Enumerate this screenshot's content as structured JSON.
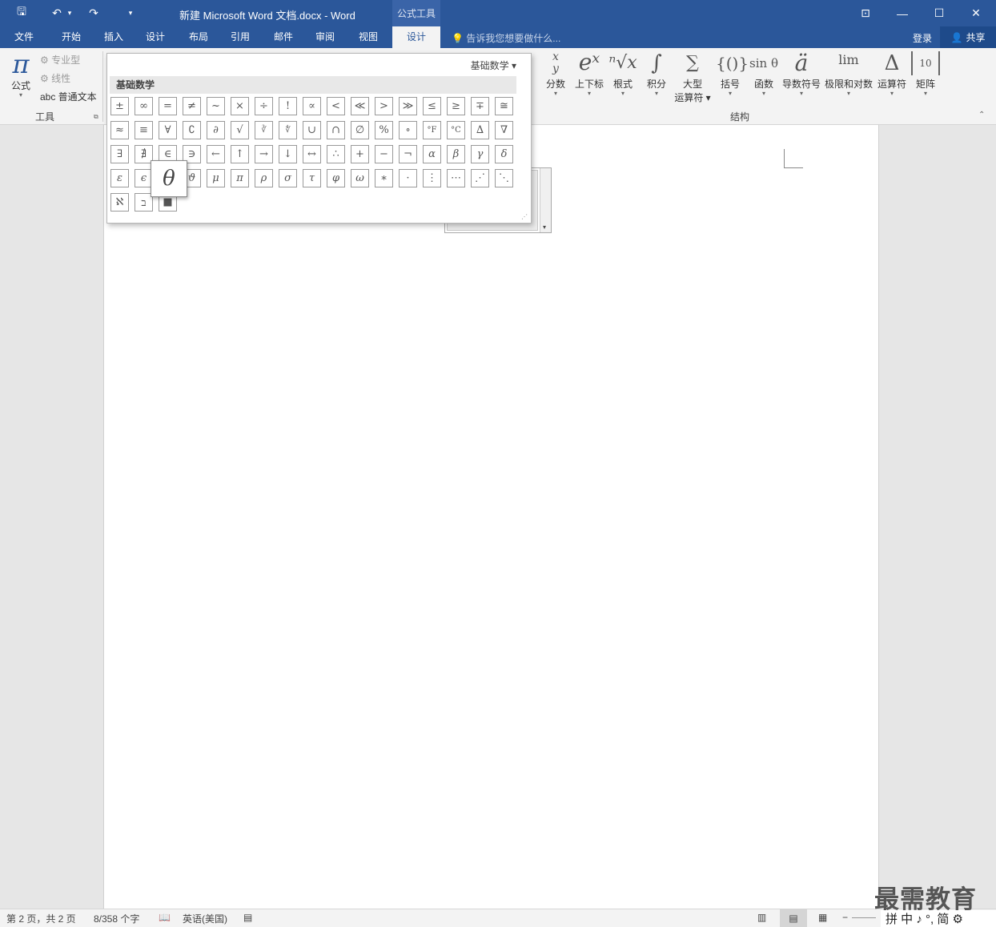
{
  "titlebar": {
    "title": "新建 Microsoft Word 文档.docx - Word",
    "context_group": "公式工具",
    "qa_save": "🖫",
    "qa_undo": "↶",
    "qa_undo_caret": "▾",
    "qa_redo": "↷",
    "qa_customize": "▾",
    "ribbon_display": "⊡",
    "minimize": "—",
    "maximize": "☐",
    "close": "✕"
  },
  "tabs": [
    "文件",
    "开始",
    "插入",
    "设计",
    "布局",
    "引用",
    "邮件",
    "审阅",
    "视图",
    "设计"
  ],
  "tell_me": "告诉我您想要做什么...",
  "login": "登录",
  "share": "共享",
  "ribbon": {
    "tools": {
      "formula_icon": "π",
      "formula_label": "公式",
      "professional": "专业型",
      "linear": "线性",
      "normal_text": "abc 普通文本",
      "group_label": "工具"
    },
    "structures": {
      "group_label": "结构",
      "buttons": [
        {
          "icon": "x⁄y",
          "label": "分数"
        },
        {
          "icon": "eˣ",
          "label": "上下标"
        },
        {
          "icon": "ⁿ√x",
          "label": "根式"
        },
        {
          "icon": "∫",
          "label": "积分"
        },
        {
          "icon": "∑",
          "label": "大型",
          "label2": "运算符"
        },
        {
          "icon": "{()}",
          "label": "括号"
        },
        {
          "icon": "sin θ",
          "label": "函数"
        },
        {
          "icon": "ä",
          "label": "导数符号"
        },
        {
          "icon": "lim",
          "label": "极限和对数"
        },
        {
          "icon": "Δ",
          "label": "运算符"
        },
        {
          "icon": "[10 01]",
          "label": "矩阵"
        }
      ]
    }
  },
  "gallery": {
    "dropdown_label": "基础数学 ▾",
    "header": "基础数学",
    "rows": [
      [
        "±",
        "∞",
        "=",
        "≠",
        "~",
        "×",
        "÷",
        "!",
        "∝",
        "<",
        "≪",
        ">",
        "≫",
        "≤",
        "≥",
        "∓",
        "≅"
      ],
      [
        "≈",
        "≡",
        "∀",
        "∁",
        "∂",
        "√",
        "∛",
        "∜",
        "∪",
        "∩",
        "∅",
        "%",
        "∘",
        "°F",
        "°C",
        "∆",
        "∇"
      ],
      [
        "∃",
        "∄",
        "∈",
        "∋",
        "←",
        "↑",
        "→",
        "↓",
        "↔",
        "∴",
        "+",
        "−",
        "¬",
        "α",
        "β",
        "γ",
        "δ"
      ],
      [
        "ε",
        "ϵ",
        "θ",
        "ϑ",
        "μ",
        "π",
        "ρ",
        "σ",
        "τ",
        "φ",
        "ω",
        "∗",
        "·",
        "⋮",
        "⋯",
        "⋰",
        "⋱"
      ],
      [
        "ℵ",
        "ב",
        "■"
      ]
    ],
    "tooltip_symbol": "θ"
  },
  "statusbar": {
    "page": "第 2 页，共 2 页",
    "words": "8/358 个字",
    "language": "英语(美国)"
  },
  "watermark": "最需教育",
  "ime": "拼 中 ♪ °, 简 ⚙"
}
